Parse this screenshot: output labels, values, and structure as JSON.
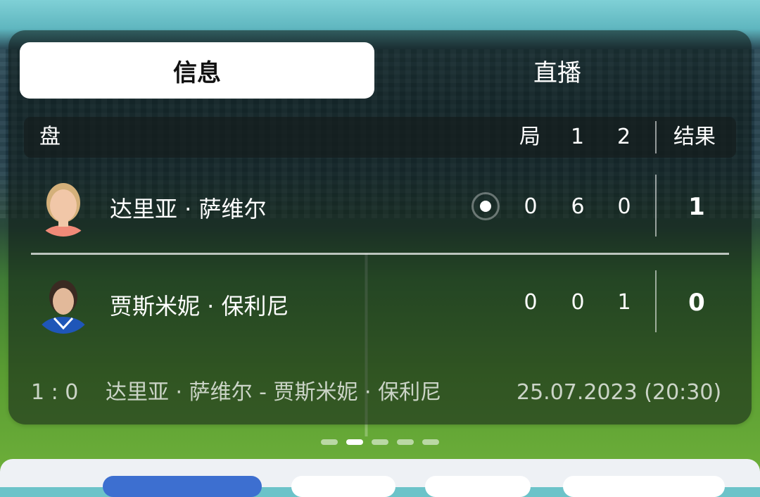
{
  "tabs": [
    {
      "label": "信息",
      "active": true
    },
    {
      "label": "直播",
      "active": false
    }
  ],
  "header": {
    "set_label": "盘",
    "game_label": "局",
    "set1_label": "1",
    "set2_label": "2",
    "result_label": "结果"
  },
  "players": [
    {
      "name": "达里亚 · 萨维尔",
      "game": "0",
      "set1": "6",
      "set2": "0",
      "result": "1",
      "serving": true
    },
    {
      "name": "贾斯米妮 · 保利尼",
      "game": "0",
      "set1": "0",
      "set2": "1",
      "result": "0",
      "serving": false
    }
  ],
  "footer": {
    "score": "1 : 0",
    "matchup": "达里亚 · 萨维尔 - 贾斯米妮 · 保利尼",
    "datetime": "25.07.2023 (20:30)"
  },
  "pagination": {
    "count": 5,
    "active_index": 1
  },
  "colors": {
    "accent": "#3d6fd0",
    "text": "#ffffff"
  }
}
